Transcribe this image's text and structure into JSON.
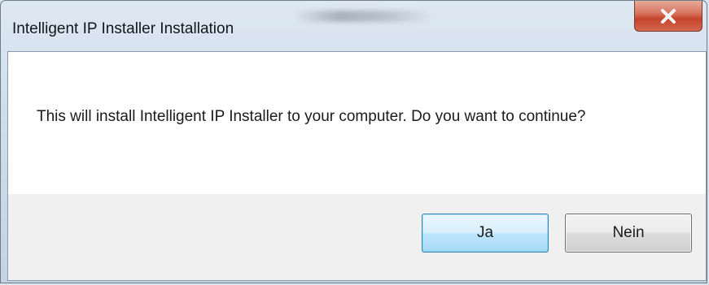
{
  "window": {
    "title": "Intelligent IP Installer Installation",
    "close_icon": "close-icon"
  },
  "dialog": {
    "message": "This will install Intelligent IP Installer to your computer. Do you want to continue?"
  },
  "buttons": {
    "yes_label": "Ja",
    "no_label": "Nein"
  },
  "colors": {
    "close_button": "#c4442b",
    "default_button_border": "#3c7fb1",
    "message_background": "#ffffff",
    "button_area_background": "#f0f0f0"
  }
}
